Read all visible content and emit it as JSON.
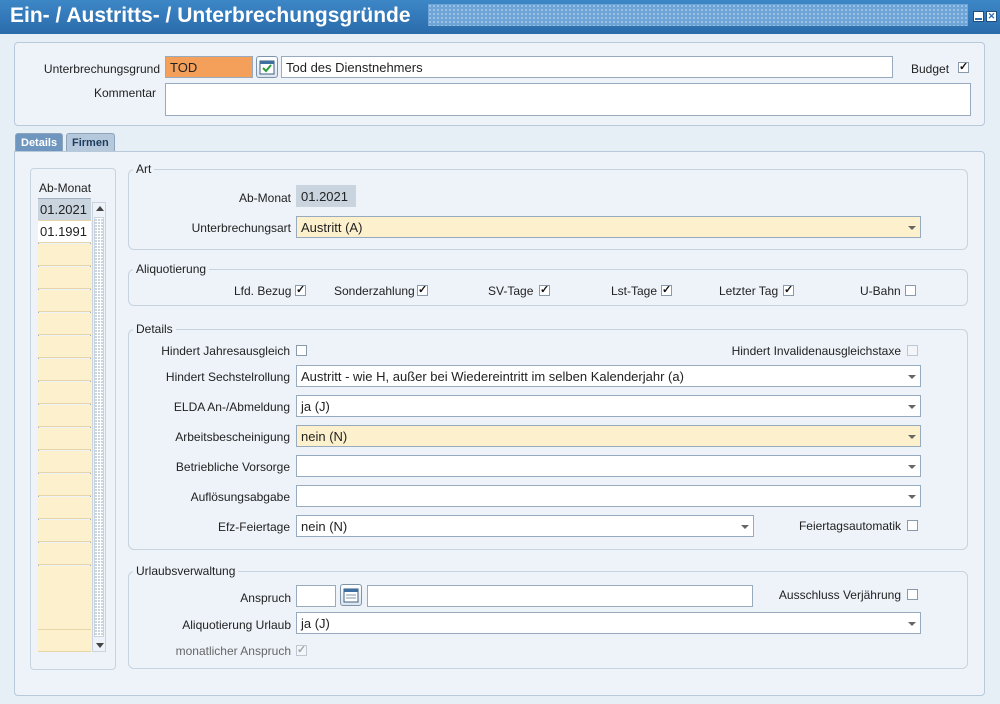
{
  "window": {
    "title": "Ein- / Austritts- / Unterbrechungsgründe"
  },
  "header": {
    "unterbrechungsgrund_label": "Unterbrechungsgrund",
    "unterbrechungsgrund_code": "TOD",
    "unterbrechungsgrund_text": "Tod des Dienstnehmers",
    "budget_label": "Budget",
    "budget_checked": true,
    "kommentar_label": "Kommentar",
    "kommentar_value": ""
  },
  "tabs": [
    {
      "label": "Details"
    },
    {
      "label": "Firmen"
    }
  ],
  "ab_monat_list": {
    "header": "Ab-Monat",
    "items": [
      "01.2021",
      "01.1991"
    ]
  },
  "art": {
    "title": "Art",
    "ab_monat_label": "Ab-Monat",
    "ab_monat_value": "01.2021",
    "unterbrechungsart_label": "Unterbrechungsart",
    "unterbrechungsart_value": "Austritt (A)"
  },
  "aliquotierung": {
    "title": "Aliquotierung",
    "items": [
      {
        "label": "Lfd. Bezug",
        "checked": true
      },
      {
        "label": "Sonderzahlung",
        "checked": true
      },
      {
        "label": "SV-Tage",
        "checked": true
      },
      {
        "label": "Lst-Tage",
        "checked": true
      },
      {
        "label": "Letzter Tag",
        "checked": true
      },
      {
        "label": "U-Bahn",
        "checked": false
      }
    ]
  },
  "details": {
    "title": "Details",
    "jahresausgleich_label": "Hindert Jahresausgleich",
    "invalidenausgleichstaxe_label": "Hindert Invalidenausgleichstaxe",
    "sechstelrollung_label": "Hindert Sechstelrollung",
    "sechstelrollung_value": "Austritt - wie H, außer bei Wiedereintritt im selben Kalenderjahr (a)",
    "elda_label": "ELDA An-/Abmeldung",
    "elda_value": "ja (J)",
    "arbeitsbescheinigung_label": "Arbeitsbescheinigung",
    "arbeitsbescheinigung_value": "nein (N)",
    "vorsorge_label": "Betriebliche Vorsorge",
    "vorsorge_value": "",
    "aufloesungsabgabe_label": "Auflösungsabgabe",
    "aufloesungsabgabe_value": "",
    "efz_label": "Efz-Feiertage",
    "efz_value": "nein (N)",
    "feiertagsautomatik_label": "Feiertagsautomatik"
  },
  "urlaub": {
    "title": "Urlaubsverwaltung",
    "anspruch_label": "Anspruch",
    "anspruch_value": "",
    "anspruch_text": "",
    "verjaehrung_label": "Ausschluss Verjährung",
    "aliquotierung_urlaub_label": "Aliquotierung Urlaub",
    "aliquotierung_urlaub_value": "ja (J)",
    "monatlich_label": "monatlicher Anspruch",
    "monatlich_checked": true
  },
  "colors": {
    "titlebar": "#2f74b8",
    "focus_field": "#f5a05a",
    "required_field": "#fdf0cc"
  }
}
